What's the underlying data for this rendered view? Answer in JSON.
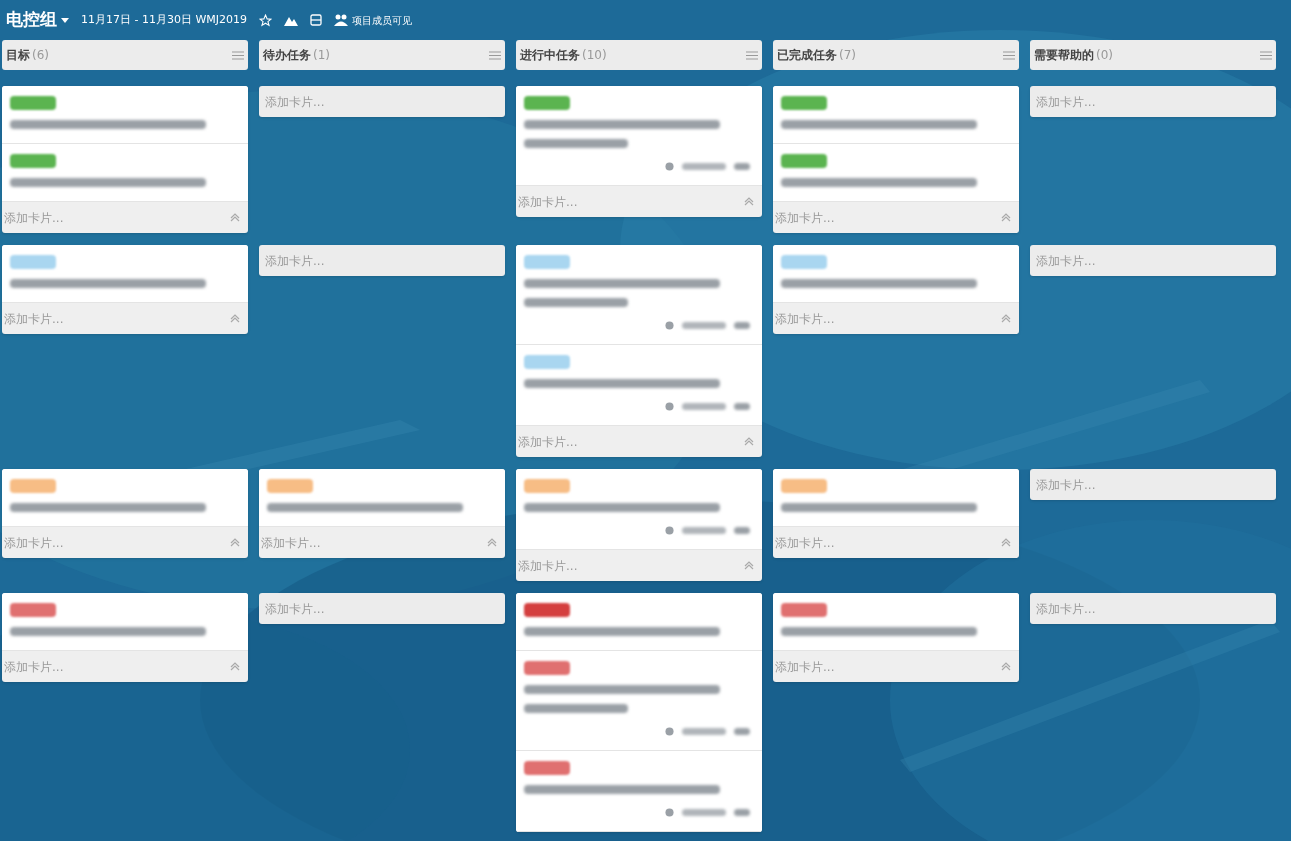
{
  "header": {
    "title": "电控组",
    "subtitle": "11月17日 - 11月30日 WMJ2019",
    "visibility": "项目成员可见"
  },
  "columns": [
    {
      "name": "目标",
      "count": "(6)"
    },
    {
      "name": "待办任务",
      "count": "(1)"
    },
    {
      "name": "进行中任务",
      "count": "(10)"
    },
    {
      "name": "已完成任务",
      "count": "(7)"
    },
    {
      "name": "需要帮助的",
      "count": "(0)"
    }
  ],
  "lanes": [
    {
      "cells": [
        {
          "cards": [
            {
              "color": "#5bb450",
              "kind": "brief"
            },
            {
              "color": "#5bb450",
              "kind": "brief"
            }
          ],
          "add_card": "添加卡片..."
        },
        {
          "add_card": "添加卡片..."
        },
        {
          "cards": [
            {
              "color": "#5bb450",
              "kind": "detailed"
            }
          ],
          "add_card": "添加卡片..."
        },
        {
          "cards": [
            {
              "color": "#5bb450",
              "kind": "brief"
            },
            {
              "color": "#5bb450",
              "kind": "brief"
            }
          ],
          "add_card": "添加卡片..."
        },
        {
          "add_card": "添加卡片..."
        }
      ]
    },
    {
      "cells": [
        {
          "cards": [
            {
              "color": "#a9d6f0",
              "kind": "brief"
            }
          ],
          "add_card": "添加卡片..."
        },
        {
          "add_card": "添加卡片..."
        },
        {
          "cards": [
            {
              "color": "#a9d6f0",
              "kind": "detailed"
            },
            {
              "color": "#a9d6f0",
              "kind": "dated"
            }
          ],
          "add_card": "添加卡片..."
        },
        {
          "cards": [
            {
              "color": "#a9d6f0",
              "kind": "brief"
            }
          ],
          "add_card": "添加卡片..."
        },
        {
          "add_card": "添加卡片..."
        }
      ]
    },
    {
      "cells": [
        {
          "cards": [
            {
              "color": "#f7bd85",
              "kind": "brief"
            }
          ],
          "add_card": "添加卡片..."
        },
        {
          "cards": [
            {
              "color": "#f7bd85",
              "kind": "brief"
            }
          ],
          "add_card": "添加卡片..."
        },
        {
          "cards": [
            {
              "color": "#f7bd85",
              "kind": "dated"
            }
          ],
          "add_card": "添加卡片..."
        },
        {
          "cards": [
            {
              "color": "#f7bd85",
              "kind": "brief"
            }
          ],
          "add_card": "添加卡片..."
        },
        {
          "add_card": "添加卡片..."
        }
      ]
    },
    {
      "cells": [
        {
          "cards": [
            {
              "color": "#e07070",
              "kind": "brief"
            }
          ],
          "add_card": "添加卡片..."
        },
        {
          "add_card": "添加卡片..."
        },
        {
          "cards": [
            {
              "color": "#d43f3f",
              "kind": "brief"
            },
            {
              "color": "#e07070",
              "kind": "detailed"
            },
            {
              "color": "#e07070",
              "kind": "dated"
            }
          ]
        },
        {
          "cards": [
            {
              "color": "#e07070",
              "kind": "brief"
            }
          ],
          "add_card": "添加卡片..."
        },
        {
          "add_card": "添加卡片..."
        }
      ]
    }
  ]
}
